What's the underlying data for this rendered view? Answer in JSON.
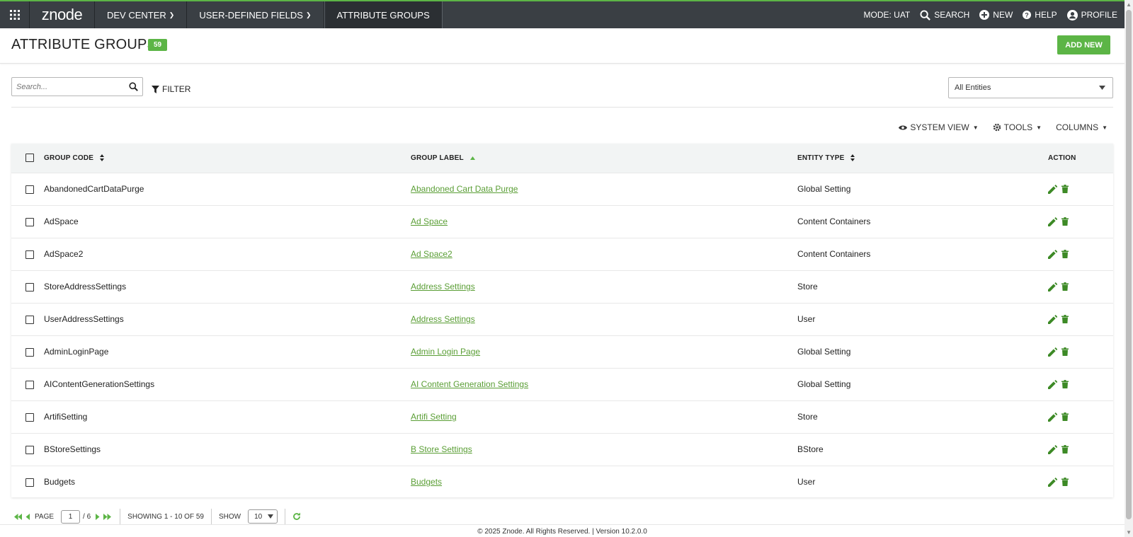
{
  "topbar": {
    "logo": "znode",
    "nav": [
      {
        "label": "DEV CENTER",
        "dropdown": true
      },
      {
        "label": "USER-DEFINED FIELDS",
        "dropdown": true
      },
      {
        "label": "ATTRIBUTE GROUPS",
        "dropdown": false
      }
    ],
    "mode": "MODE: UAT",
    "search": "SEARCH",
    "new": "NEW",
    "help": "HELP",
    "profile": "PROFILE"
  },
  "header": {
    "title": "ATTRIBUTE GROUPS",
    "count": "59",
    "add_new": "ADD NEW"
  },
  "filters": {
    "search_placeholder": "Search...",
    "filter_label": "FILTER",
    "entity_select": "All Entities"
  },
  "toolbar": {
    "system_view": "SYSTEM VIEW",
    "tools": "TOOLS",
    "columns": "COLUMNS"
  },
  "table": {
    "headers": {
      "code": "GROUP CODE",
      "label": "GROUP LABEL",
      "type": "ENTITY TYPE",
      "action": "ACTION"
    },
    "rows": [
      {
        "code": "AbandonedCartDataPurge",
        "label": "Abandoned Cart Data Purge",
        "type": "Global Setting"
      },
      {
        "code": "AdSpace",
        "label": "Ad Space",
        "type": "Content Containers"
      },
      {
        "code": "AdSpace2",
        "label": "Ad Space2",
        "type": "Content Containers"
      },
      {
        "code": "StoreAddressSettings",
        "label": "Address Settings",
        "type": "Store"
      },
      {
        "code": "UserAddressSettings",
        "label": "Address Settings",
        "type": "User"
      },
      {
        "code": "AdminLoginPage",
        "label": "Admin Login Page",
        "type": "Global Setting"
      },
      {
        "code": "AIContentGenerationSettings",
        "label": "AI Content Generation Settings",
        "type": "Global Setting"
      },
      {
        "code": "ArtifiSetting",
        "label": "Artifi Setting",
        "type": "Store"
      },
      {
        "code": "BStoreSettings",
        "label": "B Store Settings",
        "type": "BStore"
      },
      {
        "code": "Budgets",
        "label": "Budgets",
        "type": "User"
      }
    ]
  },
  "pager": {
    "page_label": "PAGE",
    "current_page": "1",
    "total_pages": "/ 6",
    "showing": "SHOWING 1 - 10 OF 59",
    "show_label": "SHOW",
    "page_size": "10"
  },
  "footer": "© 2025 Znode. All Rights Reserved. | Version 10.2.0.0",
  "colors": {
    "accent": "#5cb546",
    "topbar": "#3a3f44",
    "link": "#5a9e35"
  }
}
